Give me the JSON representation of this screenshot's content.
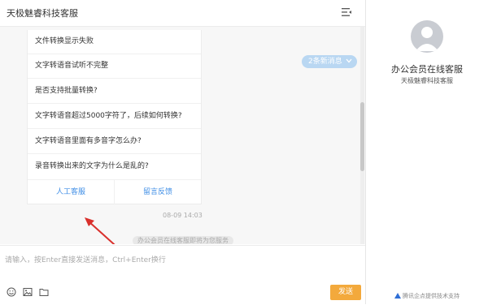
{
  "header": {
    "title": "天极魅睿科技客服",
    "menu_icon": "list-collapse-icon"
  },
  "faq": {
    "items": [
      "文件转换显示失败",
      "文字转语音试听不完整",
      "是否支持批量转换?",
      "文字转语音超过5000字符了，后续如何转换?",
      "文字转语音里面有多音字怎么办?",
      "录音转换出来的文字为什么是乱的?"
    ],
    "actions": {
      "human": "人工客服",
      "feedback": "留言反馈"
    }
  },
  "chat": {
    "new_messages": "2条新消息",
    "timestamp": "08-09 14:03",
    "system_note": "办公会员在线客服即将为您服务"
  },
  "input": {
    "placeholder": "请输入，按Enter直接发送消息，Ctrl+Enter换行",
    "value": "",
    "toolbar_icons": [
      "emoji-icon",
      "image-icon",
      "folder-icon"
    ],
    "send_label": "发送"
  },
  "agent": {
    "name": "办公会员在线客服",
    "company": "天极魅睿科技客服",
    "support": "腾讯企点提供技术支持"
  },
  "colors": {
    "accent": "#3f8ee6",
    "send": "#f3a93c",
    "new_msg_bg": "#b9d7f2"
  }
}
